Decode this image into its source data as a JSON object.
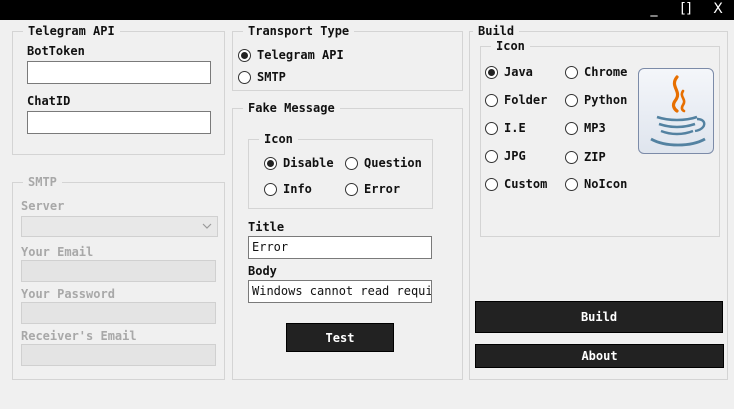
{
  "window": {
    "minimize": "_",
    "maximize": "[]",
    "close": "X"
  },
  "telegram": {
    "title": "Telegram API",
    "bot_token_label": "BotToken",
    "bot_token_value": "",
    "chat_id_label": "ChatID",
    "chat_id_value": ""
  },
  "smtp": {
    "title": "SMTP",
    "server_label": "Server",
    "email_label": "Your Email",
    "password_label": "Your Password",
    "receiver_label": "Receiver's Email"
  },
  "transport": {
    "title": "Transport Type",
    "options": [
      "Telegram API",
      "SMTP"
    ],
    "selected": "Telegram API"
  },
  "fake_message": {
    "title": "Fake Message",
    "icon_group_title": "Icon",
    "icons": [
      "Disable",
      "Question",
      "Info",
      "Error"
    ],
    "selected_icon": "Disable",
    "title_label": "Title",
    "title_value": "Error",
    "body_label": "Body",
    "body_value": "Windows cannot read required",
    "test_button": "Test"
  },
  "build": {
    "title": "Build",
    "icon_group_title": "Icon",
    "icons": [
      "Java",
      "Chrome",
      "Folder",
      "Python",
      "I.E",
      "MP3",
      "JPG",
      "ZIP",
      "Custom",
      "NoIcon"
    ],
    "selected_icon": "Java",
    "build_button": "Build",
    "about_button": "About"
  },
  "colors": {
    "background": "#f0f0f0",
    "titlebar": "#000000",
    "button": "#222222",
    "disabled_text": "#a8a8a8"
  }
}
